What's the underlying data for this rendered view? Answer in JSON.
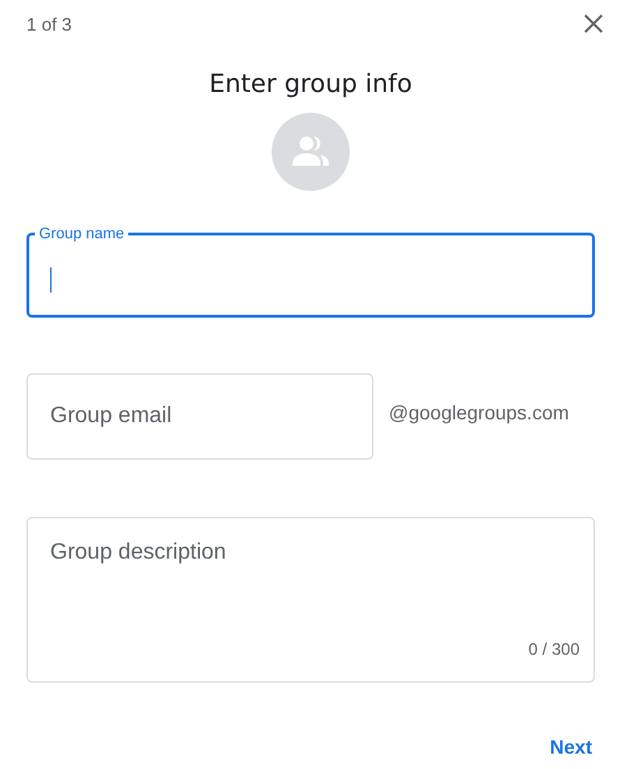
{
  "step": "1 of 3",
  "title": "Enter group info",
  "fields": [
    {
      "kind": "outlined",
      "label": "Group name",
      "focused": true
    },
    {
      "kind": "email",
      "placeholder": "Group email",
      "focused": false,
      "suffix": "@googlegroups.com"
    },
    {
      "kind": "textarea",
      "placeholder": "Group description",
      "focused": false,
      "counter": "0 / 300"
    }
  ],
  "next_button": "Next"
}
